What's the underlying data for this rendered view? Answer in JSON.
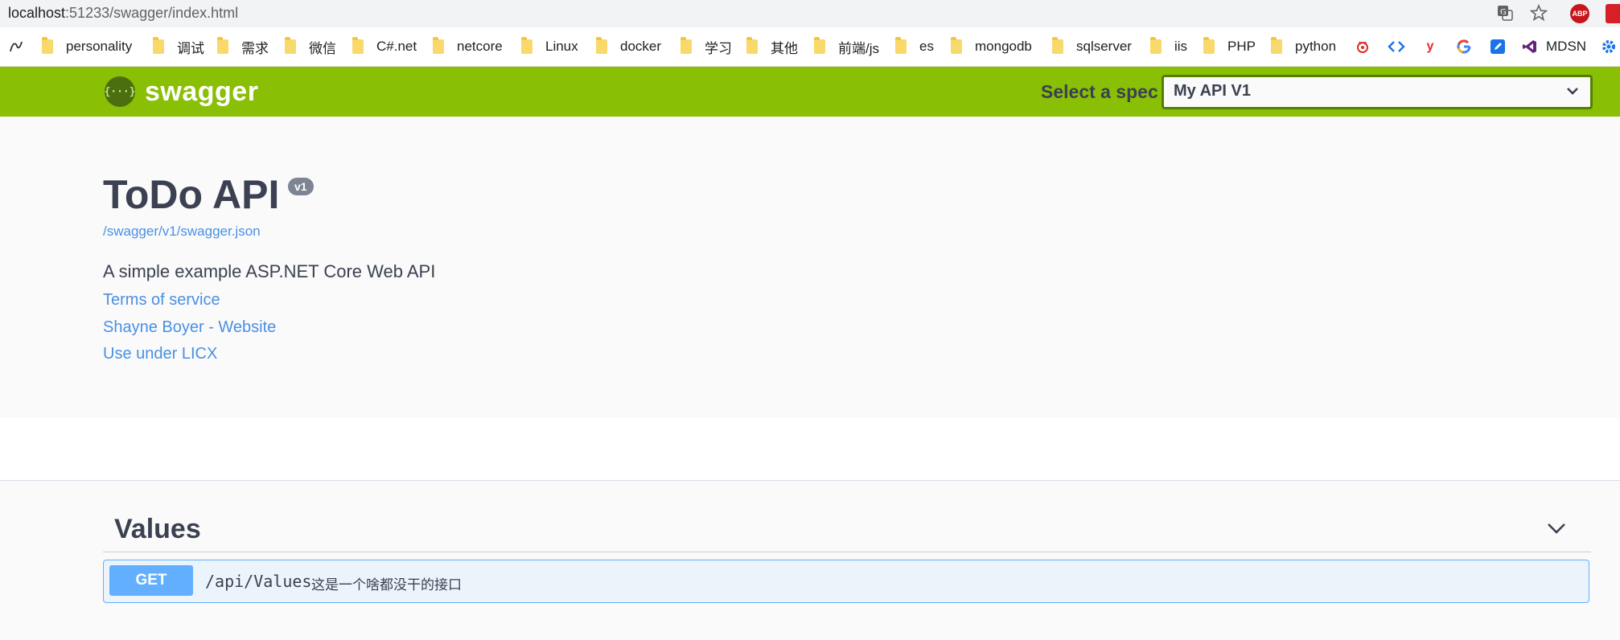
{
  "browser": {
    "url_host": "localhost",
    "url_rest": ":51233/swagger/index.html",
    "translate_icon": "translate-icon",
    "star_icon": "star-icon"
  },
  "bookmarks": [
    {
      "label": "personality"
    },
    {
      "label": "调试"
    },
    {
      "label": "需求"
    },
    {
      "label": "微信"
    },
    {
      "label": "C#.net"
    },
    {
      "label": "netcore"
    },
    {
      "label": "Linux"
    },
    {
      "label": "docker"
    },
    {
      "label": "学习"
    },
    {
      "label": "其他"
    },
    {
      "label": "前端/js"
    },
    {
      "label": "es"
    },
    {
      "label": "mongodb"
    },
    {
      "label": "sqlserver"
    },
    {
      "label": "iis"
    },
    {
      "label": "PHP"
    },
    {
      "label": "python"
    }
  ],
  "bookmark_mdsn": "MDSN",
  "extensions": {
    "abp": "ABP"
  },
  "topbar": {
    "logo_symbol": "{···}",
    "logo_text": "swagger",
    "spec_label": "Select a spec",
    "spec_value": "My API V1",
    "accent": "#89bf04"
  },
  "info": {
    "title": "ToDo API",
    "version": "v1",
    "spec_link": "/swagger/v1/swagger.json",
    "description": "A simple example ASP.NET Core Web API",
    "terms": "Terms of service",
    "contact": "Shayne Boyer - Website",
    "license": "Use under LICX"
  },
  "operations": {
    "tag": "Values",
    "items": [
      {
        "method": "GET",
        "path": "/api/Values",
        "summary": "这是一个啥都没干的接口",
        "color": "#61affe"
      }
    ]
  }
}
